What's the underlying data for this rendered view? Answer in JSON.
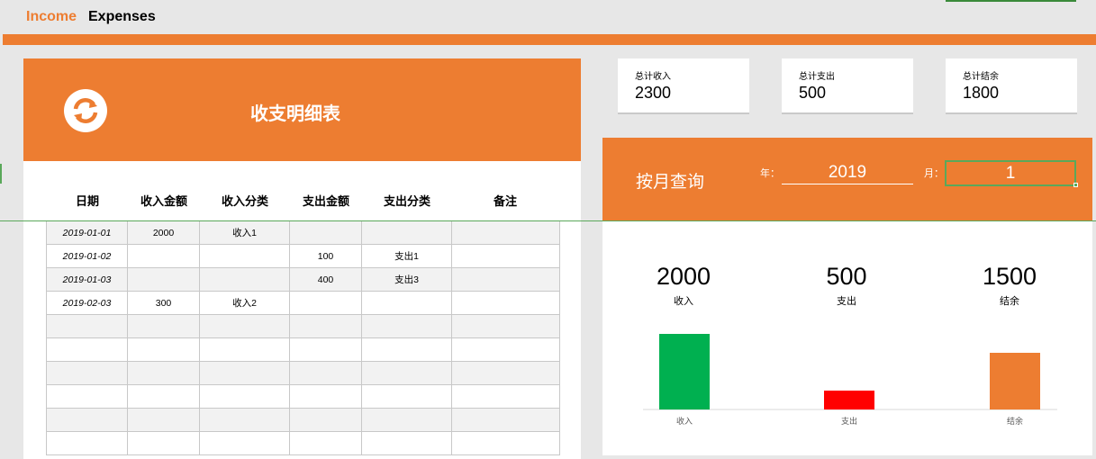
{
  "header": {
    "title_income": "Income",
    "title_expenses": "Expenses"
  },
  "ledger": {
    "title": "收支明细表",
    "columns": [
      "日期",
      "收入金额",
      "收入分类",
      "支出金额",
      "支出分类",
      "备注"
    ],
    "rows": [
      [
        "2019-01-01",
        "2000",
        "收入1",
        "",
        "",
        ""
      ],
      [
        "2019-01-02",
        "",
        "",
        "100",
        "支出1",
        ""
      ],
      [
        "2019-01-03",
        "",
        "",
        "400",
        "支出3",
        ""
      ],
      [
        "2019-02-03",
        "300",
        "收入2",
        "",
        "",
        ""
      ],
      [
        "",
        "",
        "",
        "",
        "",
        ""
      ],
      [
        "",
        "",
        "",
        "",
        "",
        ""
      ],
      [
        "",
        "",
        "",
        "",
        "",
        ""
      ],
      [
        "",
        "",
        "",
        "",
        "",
        ""
      ],
      [
        "",
        "",
        "",
        "",
        "",
        ""
      ],
      [
        "",
        "",
        "",
        "",
        "",
        ""
      ]
    ]
  },
  "summary": {
    "total_income": {
      "label": "总计收入",
      "value": "2300"
    },
    "total_expense": {
      "label": "总计支出",
      "value": "500"
    },
    "total_balance": {
      "label": "总计结余",
      "value": "1800"
    }
  },
  "query": {
    "title": "按月查询",
    "year_label": "年：",
    "year_value": "2019",
    "month_label": "月：",
    "month_value": "1"
  },
  "monthly_stats": {
    "income": {
      "value": "2000",
      "label": "收入"
    },
    "expense": {
      "value": "500",
      "label": "支出"
    },
    "balance": {
      "value": "1500",
      "label": "结余"
    }
  },
  "chart_data": {
    "type": "bar",
    "categories": [
      "收入",
      "支出",
      "结余"
    ],
    "values": [
      2000,
      500,
      1500
    ],
    "colors": [
      "#00b050",
      "#ff0000",
      "#ed7d31"
    ],
    "ylim": [
      0,
      2000
    ]
  },
  "colors": {
    "accent": "#ed7d31",
    "income": "#00b050",
    "expense": "#ff0000",
    "selection": "#5aa85a"
  },
  "icons": {
    "refresh": "refresh-icon"
  }
}
